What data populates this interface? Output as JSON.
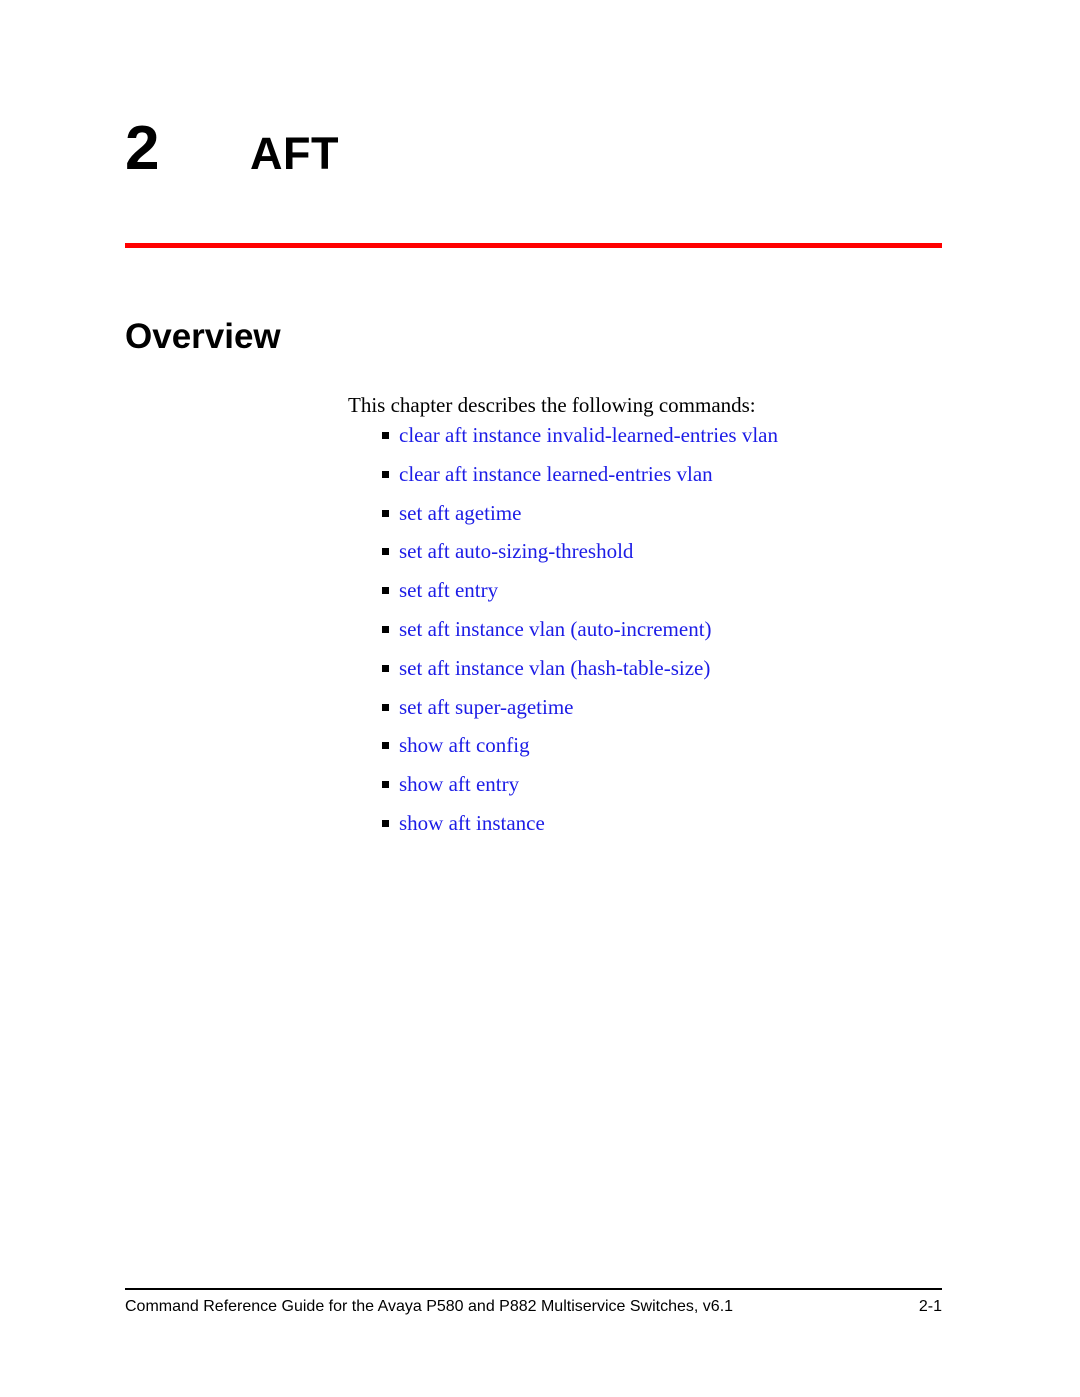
{
  "document": {
    "chapter_number": "2",
    "chapter_title": "AFT",
    "section_heading": "Overview",
    "intro_text": "This chapter describes the following commands:"
  },
  "colors": {
    "rule_red": "#ff0000",
    "link_blue": "#1c1ce6",
    "text_black": "#000000",
    "page_background": "#ffffff"
  },
  "commands": [
    {
      "label": "clear aft instance invalid-learned-entries vlan"
    },
    {
      "label": "clear aft instance learned-entries vlan"
    },
    {
      "label": "set aft agetime"
    },
    {
      "label": "set aft auto-sizing-threshold"
    },
    {
      "label": "set aft entry"
    },
    {
      "label": "set aft instance vlan (auto-increment)"
    },
    {
      "label": "set aft instance vlan (hash-table-size)"
    },
    {
      "label": "set aft super-agetime"
    },
    {
      "label": "show aft config"
    },
    {
      "label": "show aft entry"
    },
    {
      "label": "show aft instance"
    }
  ],
  "footer": {
    "text": "Command Reference Guide for the Avaya P580 and P882 Multiservice Switches, v6.1",
    "page_number": "2-1"
  }
}
